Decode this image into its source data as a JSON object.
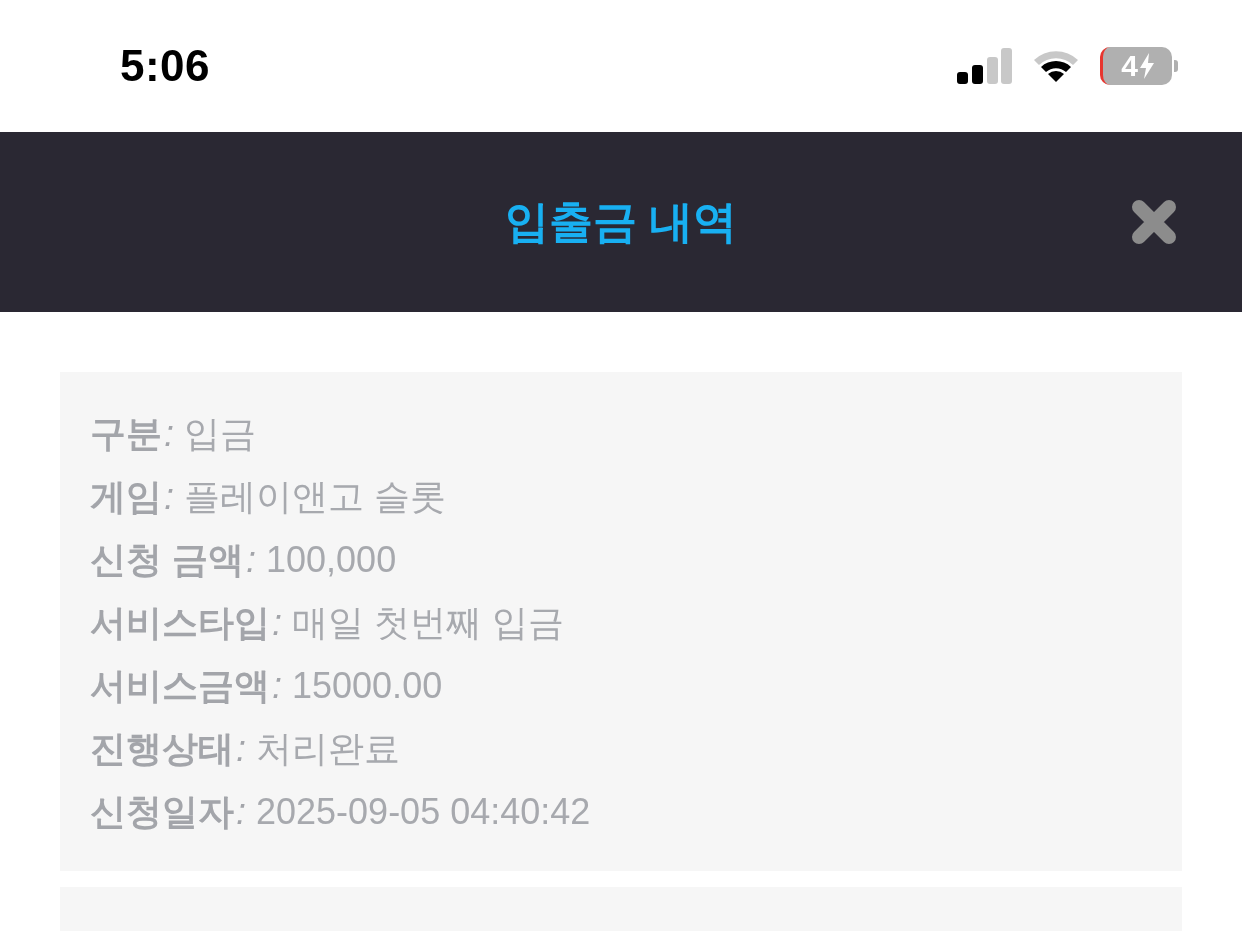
{
  "status_bar": {
    "time": "5:06",
    "battery": "4",
    "charging": true
  },
  "header": {
    "title": "입출금 내역"
  },
  "records": [
    {
      "fields": [
        {
          "label": "구분",
          "separator": ":",
          "value": "입금"
        },
        {
          "label": "게임",
          "separator": ":",
          "value": "플레이앤고 슬롯"
        },
        {
          "label": "신청 금액",
          "separator": ":",
          "value": "100,000"
        },
        {
          "label": "서비스타입",
          "separator": ":",
          "value": "매일 첫번째 입금"
        },
        {
          "label": "서비스금액",
          "separator": ":",
          "value": "15000.00"
        },
        {
          "label": "진행상태",
          "separator": ":",
          "value": "처리완료"
        },
        {
          "label": "신청일자",
          "separator": ":",
          "value": "2025-09-05 04:40:42"
        }
      ]
    }
  ],
  "list_continues": true
}
